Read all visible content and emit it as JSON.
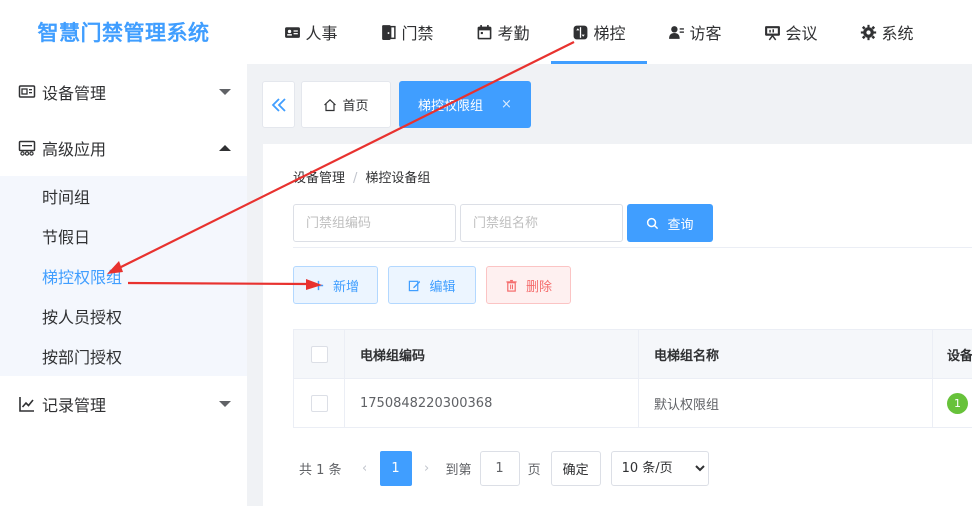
{
  "app": {
    "title": "智慧门禁管理系统"
  },
  "topnav": [
    {
      "label": "人事",
      "icon": "id-card-icon"
    },
    {
      "label": "门禁",
      "icon": "door-icon"
    },
    {
      "label": "考勤",
      "icon": "calendar-icon"
    },
    {
      "label": "梯控",
      "icon": "elevator-icon",
      "active": true
    },
    {
      "label": "访客",
      "icon": "visitor-icon"
    },
    {
      "label": "会议",
      "icon": "meeting-board-icon"
    },
    {
      "label": "系统",
      "icon": "gear-icon"
    }
  ],
  "sidebar": {
    "groups": [
      {
        "label": "设备管理",
        "icon": "device-icon",
        "expanded": false
      },
      {
        "label": "高级应用",
        "icon": "advanced-icon",
        "expanded": true,
        "items": [
          "时间组",
          "节假日",
          "梯控权限组",
          "按人员授权",
          "按部门授权"
        ],
        "active_item": "梯控权限组"
      },
      {
        "label": "记录管理",
        "icon": "chart-icon",
        "expanded": false
      }
    ]
  },
  "tabs": {
    "home_label": "首页",
    "active_label": "梯控权限组",
    "close_glyph": "×"
  },
  "breadcrumb": {
    "level1": "设备管理",
    "separator": "/",
    "level2": "梯控设备组"
  },
  "search": {
    "code_placeholder": "门禁组编码",
    "name_placeholder": "门禁组名称",
    "button_label": "查询"
  },
  "actions": {
    "add": "新增",
    "edit": "编辑",
    "delete": "删除"
  },
  "table": {
    "headers": [
      "电梯组编码",
      "电梯组名称",
      "设备"
    ],
    "rows": [
      {
        "code": "1750848220300368",
        "name": "默认权限组",
        "device_count": "1"
      }
    ]
  },
  "pagination": {
    "total_text": "共 1 条",
    "current_page": "1",
    "goto_label": "到第",
    "goto_value": "1",
    "page_unit": "页",
    "confirm_label": "确定",
    "page_size": "10 条/页",
    "page_size_options": [
      "10 条/页"
    ]
  },
  "colors": {
    "primary": "#409eff",
    "danger": "#f56c6c",
    "success": "#67c23a",
    "annotation": "#e8322f"
  }
}
